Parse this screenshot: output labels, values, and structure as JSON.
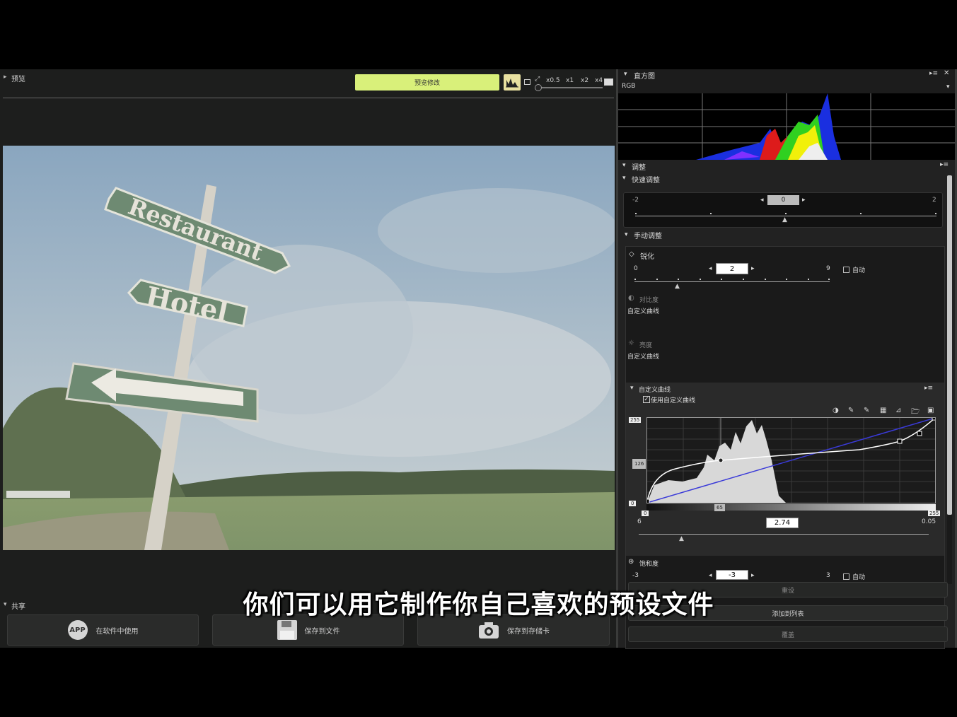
{
  "preview": {
    "panel_title": "预览",
    "preview_button": "预览修改",
    "zoom_options": [
      "x0.5",
      "x1",
      "x2",
      "x4"
    ]
  },
  "share": {
    "title": "共享",
    "buttons": [
      {
        "label": "在软件中使用",
        "icon": "app-icon"
      },
      {
        "label": "保存到文件",
        "icon": "floppy-disk-icon"
      },
      {
        "label": "保存到存储卡",
        "icon": "camera-icon"
      }
    ]
  },
  "histogram": {
    "title": "直方图",
    "channel": "RGB"
  },
  "adjust": {
    "title": "调整",
    "quick": {
      "title": "快速调整",
      "min": "-2",
      "max": "2",
      "value": "0"
    },
    "manual": {
      "title": "手动调整",
      "sharpen": {
        "label": "锐化",
        "min": "0",
        "max": "9",
        "value": "2",
        "auto_label": "自动",
        "level": 0.22
      },
      "contrast": {
        "label": "对比度",
        "mode": "自定义曲线"
      },
      "brightness": {
        "label": "亮度",
        "mode": "自定义曲线"
      },
      "custom_curve": {
        "title": "自定义曲线",
        "use_label": "使用自定义曲线",
        "use_checked": true,
        "out_top": "255",
        "out_mid": "126",
        "out_bottom": "0",
        "in_left": "0",
        "in_mid": "65",
        "in_right": "255",
        "gamma_left": "6",
        "gamma_value": "2.74",
        "gamma_right": "0.05"
      },
      "saturation": {
        "label": "饱和度",
        "min": "-3",
        "max": "3",
        "value": "-3",
        "auto_label": "自动"
      }
    }
  },
  "bottom_buttons": {
    "reset": "重设",
    "add_to_list": "添加到列表",
    "overwrite": "覆盖"
  },
  "photo": {
    "signs": [
      "Restaurant",
      "Hotel"
    ]
  },
  "subtitle": "你们可以用它制作你自己喜欢的预设文件"
}
